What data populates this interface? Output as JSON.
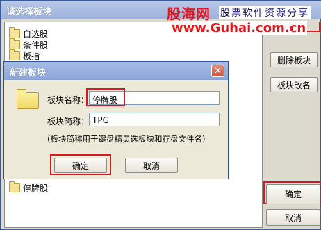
{
  "outer_window": {
    "title": "请选择板块",
    "tree_items": [
      "自选股",
      "条件股",
      "板指",
      "停牌股"
    ],
    "buttons": {
      "delete_block": "删除板块",
      "rename_block": "板块改名",
      "ok": "确定",
      "cancel": "取消"
    }
  },
  "watermark": {
    "brand": "股海网",
    "tagline": "股票软件资源分享",
    "url": "www.Guhai.com.cn"
  },
  "dialog": {
    "title": "新建板块",
    "close_glyph": "✕",
    "name_label": "板块名称：",
    "name_value": "停牌股",
    "abbr_label": "板块简称：",
    "abbr_value": "TPG",
    "hint": "(板块简称用于键盘精灵选板块和存盘文件名)",
    "ok_label": "确定",
    "cancel_label": "取消"
  },
  "colors": {
    "highlight_red": "#e0161c",
    "title_bar_blue": "#9db2dc",
    "watermark_red": "#e4161c"
  }
}
